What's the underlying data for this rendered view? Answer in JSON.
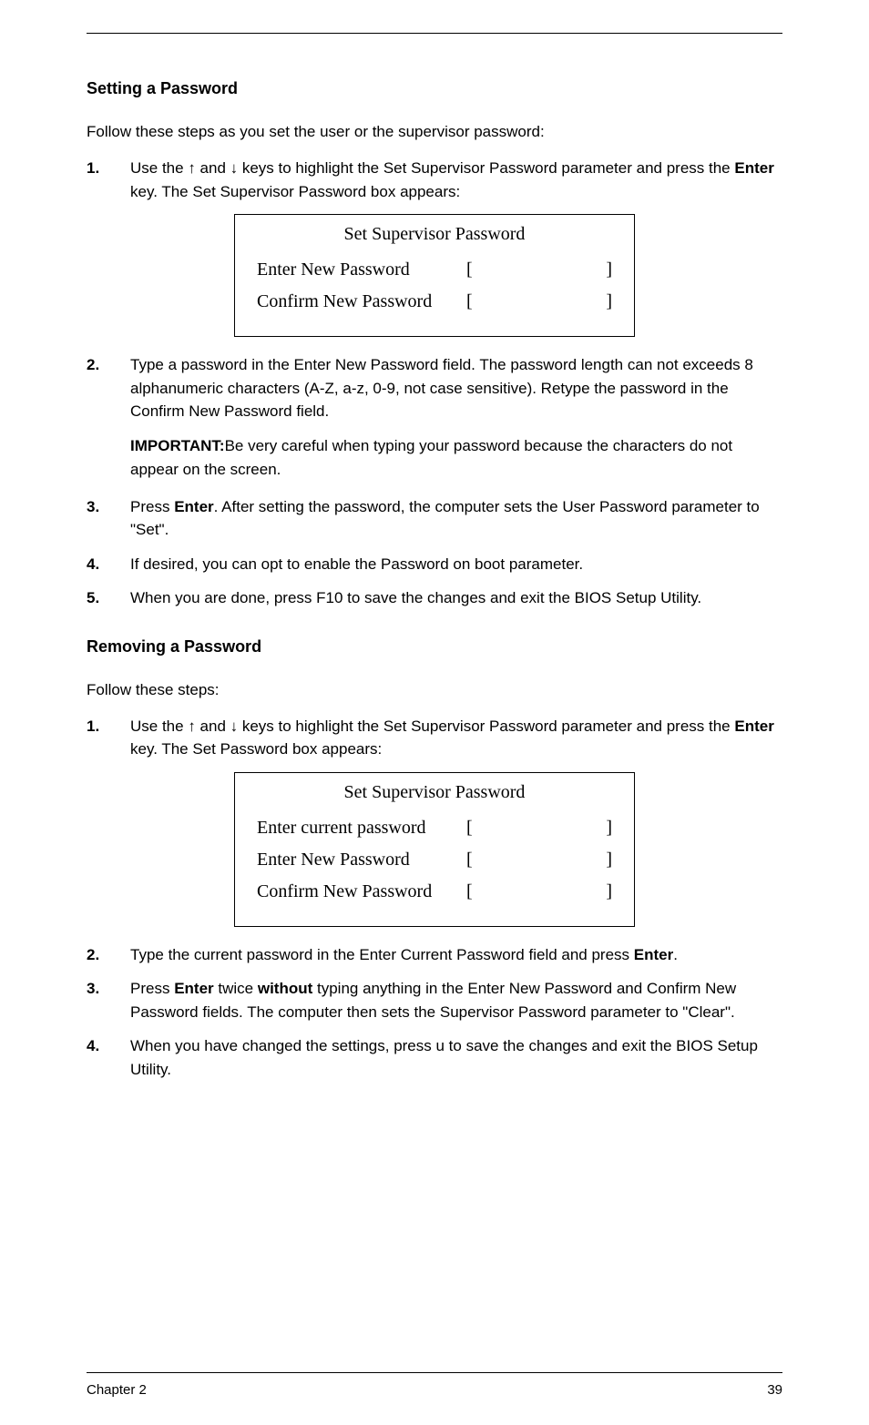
{
  "sectionA": {
    "heading": "Setting a Password",
    "intro": "Follow these steps as you set the user or the supervisor password:",
    "step1": {
      "num": "1.",
      "text_before": "Use the ",
      "arrow_up": "↑",
      "text_mid": " and ",
      "arrow_down": "↓",
      "text_after": " keys to highlight the Set Supervisor Password parameter and press the ",
      "key": "Enter",
      "text_end": " key. The Set Supervisor Password box appears:"
    },
    "dialog": {
      "title": "Set Supervisor Password",
      "rows": [
        {
          "label": "Enter New Password",
          "bl": "[",
          "br": "]"
        },
        {
          "label": "Confirm New Password",
          "bl": "[",
          "br": "]"
        }
      ]
    },
    "step2": {
      "num": "2.",
      "text": "Type a password in the Enter New Password field. The password length can not exceeds 8 alphanumeric characters (A-Z, a-z, 0-9, not case sensitive). Retype the password in the Confirm New Password field."
    },
    "important": "IMPORTANT:",
    "important_text": "Be very careful when typing your password because the characters do not appear on the screen.",
    "step3": {
      "num": "3.",
      "text_before": "Press ",
      "key": "Enter",
      "text_after": ". After setting the password, the computer sets the User Password parameter to \"Set\"."
    },
    "step4": {
      "num": "4.",
      "text": "If desired, you can opt to enable the Password on boot parameter."
    },
    "step5": {
      "num": "5.",
      "text": "When you are done, press F10 to save the changes and exit the BIOS Setup Utility."
    }
  },
  "sectionB": {
    "heading": "Removing a Password",
    "intro": "Follow these steps:",
    "step1": {
      "num": "1.",
      "text_before": "Use the ",
      "arrow_up": "↑",
      "text_mid": " and ",
      "arrow_down": "↓",
      "text_after": " keys to highlight the Set Supervisor Password parameter and press the ",
      "key": "Enter",
      "text_end": " key. The Set Password box appears:"
    },
    "dialog": {
      "title": "Set Supervisor Password",
      "rows": [
        {
          "label": "Enter current password",
          "bl": "[",
          "br": "]"
        },
        {
          "label": "Enter New Password",
          "bl": "[",
          "br": "]"
        },
        {
          "label": "Confirm New Password",
          "bl": "[",
          "br": "]"
        }
      ]
    },
    "step2": {
      "num": "2.",
      "text_before": "Type the current password in the Enter Current Password field and press ",
      "key": "Enter",
      "text_after": "."
    },
    "step3": {
      "num": "3.",
      "text_before": "Press ",
      "key1": "Enter",
      "text_mid": " twice ",
      "bold_without": "without",
      "text_after": " typing anything in the Enter New Password and Confirm New Password fields. The computer then sets the Supervisor Password parameter to \"Clear\"."
    },
    "step4": {
      "num": "4.",
      "text": "When you have changed the settings, press u to save the changes and exit the BIOS Setup Utility."
    }
  },
  "footer": {
    "left": "Chapter 2",
    "right": "39"
  }
}
